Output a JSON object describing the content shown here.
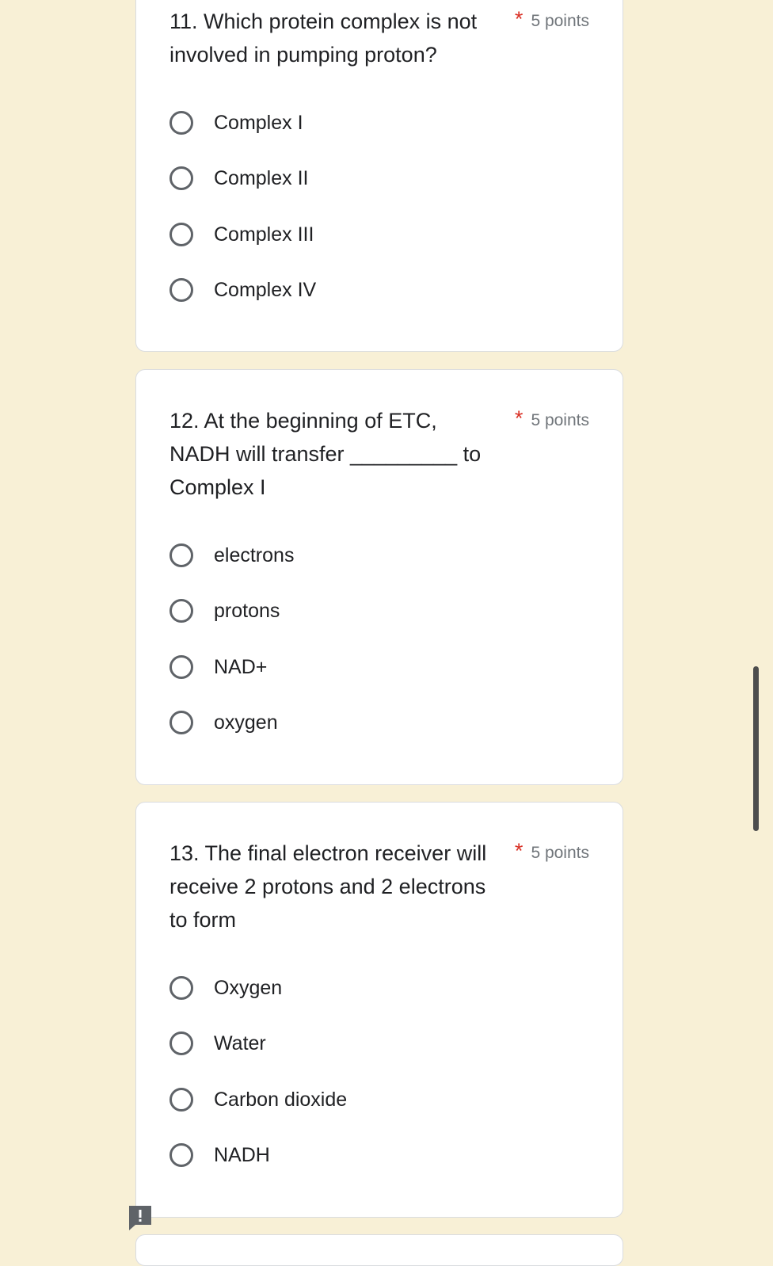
{
  "questions": [
    {
      "title": "11. Which protein complex is not\ninvolved in pumping proton?",
      "required": "*",
      "points": "5 points",
      "options": [
        "Complex I",
        "Complex II",
        "Complex III",
        "Complex IV"
      ]
    },
    {
      "title": "12. At the beginning of ETC,\nNADH will transfer _________ to\nComplex I",
      "required": "*",
      "points": "5 points",
      "options": [
        "electrons",
        "protons",
        "NAD+",
        "oxygen"
      ]
    },
    {
      "title": "13. The final electron receiver will\nreceive 2 protons and 2 electrons\nto form",
      "required": "*",
      "points": "5 points",
      "options": [
        "Oxygen",
        "Water",
        "Carbon dioxide",
        "NADH"
      ]
    }
  ],
  "icons": {
    "report": "exclamation-icon",
    "radio": "radio-unchecked-icon"
  },
  "colors": {
    "background": "#f8f0d6",
    "required": "#d93025",
    "radio_border": "#5f6368"
  }
}
